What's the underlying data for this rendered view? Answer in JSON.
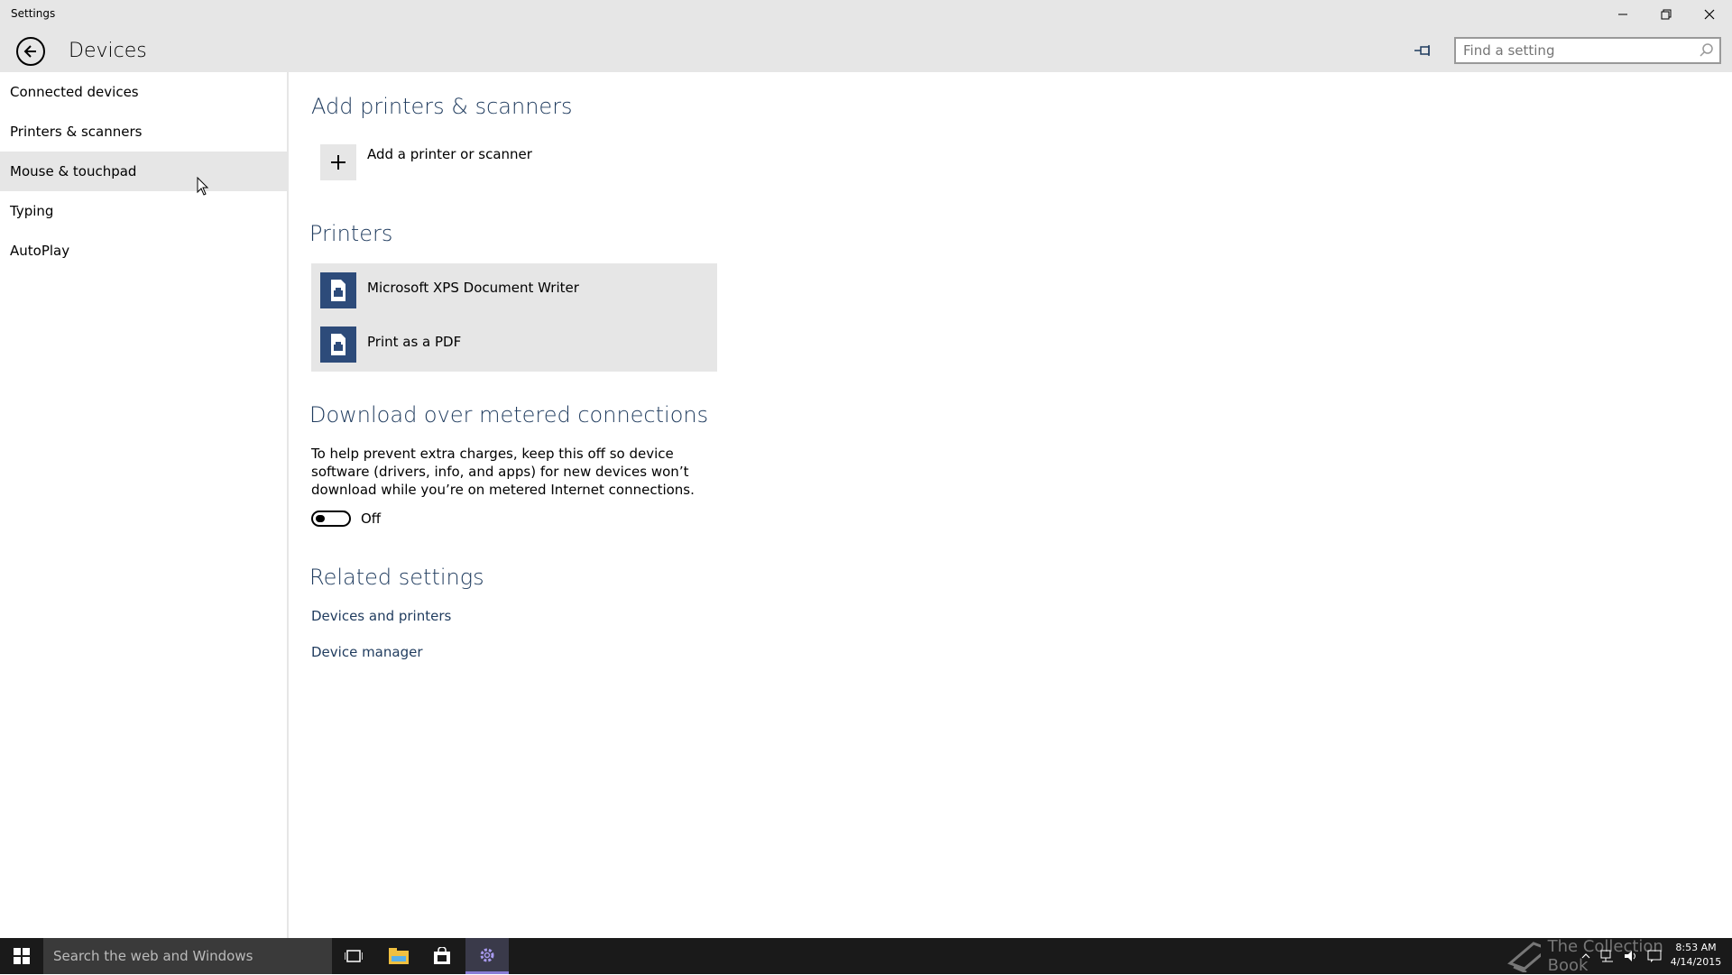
{
  "window": {
    "app_title": "Settings",
    "minimize_glyph": "—",
    "restore_glyph": "❐",
    "close_glyph": "✕"
  },
  "header": {
    "title": "Devices",
    "search_placeholder": "Find a setting"
  },
  "sidebar": {
    "items": [
      {
        "label": "Connected devices"
      },
      {
        "label": "Printers & scanners"
      },
      {
        "label": "Mouse & touchpad"
      },
      {
        "label": "Typing"
      },
      {
        "label": "AutoPlay"
      }
    ]
  },
  "content": {
    "add_section": {
      "title": "Add printers & scanners",
      "add_label": "Add a printer or scanner"
    },
    "printers_section": {
      "title": "Printers",
      "items": [
        {
          "name": "Microsoft XPS Document Writer"
        },
        {
          "name": "Print as a PDF"
        }
      ]
    },
    "metered_section": {
      "title": "Download over metered connections",
      "description": "To help prevent extra charges, keep this off so device software (drivers, info, and apps) for new devices won’t download while you’re on metered Internet connections.",
      "toggle_state": "Off"
    },
    "related_section": {
      "title": "Related settings",
      "links": [
        {
          "label": "Devices and printers"
        },
        {
          "label": "Device manager"
        }
      ]
    }
  },
  "taskbar": {
    "search_placeholder": "Search the web and Windows",
    "watermark": "The Collection Book",
    "time": "8:53 AM",
    "date": "4/14/2015"
  },
  "colors": {
    "accent_dark_blue": "#1f3b5e",
    "printer_icon_bg": "#2d4b7a",
    "chrome_gray": "#e6e6e6",
    "taskbar_bg": "#1a1a1a"
  }
}
